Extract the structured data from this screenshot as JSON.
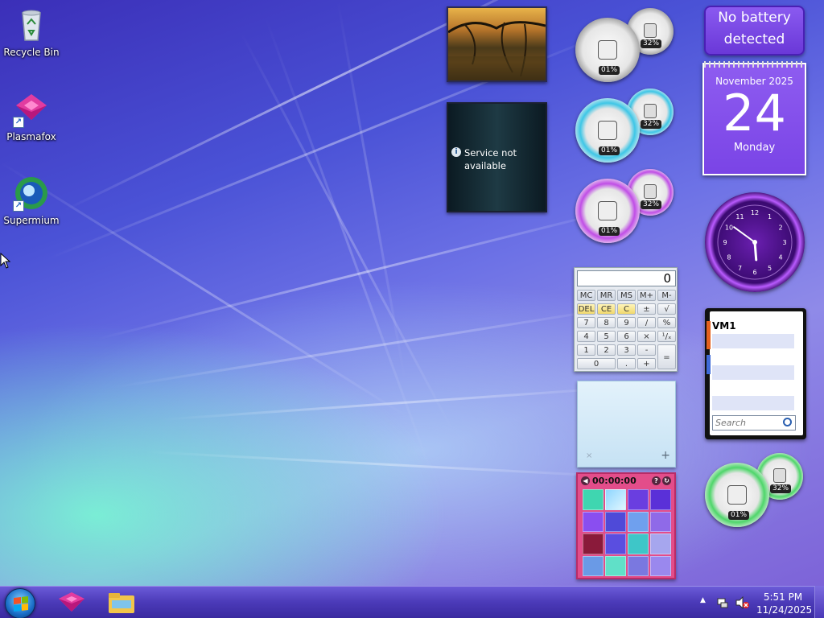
{
  "desktop": {
    "icons": [
      {
        "label": "Recycle Bin",
        "icon": "recycle-bin-icon"
      },
      {
        "label": "Plasmafox",
        "icon": "plasmafox-icon"
      },
      {
        "label": "Supermium",
        "icon": "supermium-icon"
      }
    ]
  },
  "gadgets": {
    "battery": {
      "line1": "No battery",
      "line2": "detected"
    },
    "calendar": {
      "month_year": "November 2025",
      "day": "24",
      "weekday": "Monday"
    },
    "clock": {
      "time": "5:51",
      "numerals": [
        "12",
        "1",
        "2",
        "3",
        "4",
        "5",
        "6",
        "7",
        "8",
        "9",
        "10",
        "11"
      ]
    },
    "feed": {
      "message": "Service not available"
    },
    "meters": [
      {
        "cpu": "01%",
        "memory": "32%",
        "accent": "#d8d8d8"
      },
      {
        "cpu": "01%",
        "memory": "32%",
        "accent": "#3ec6e6"
      },
      {
        "cpu": "01%",
        "memory": "32%",
        "accent": "#c04ee6"
      },
      {
        "cpu": "01%",
        "memory": "32%",
        "accent": "#4ed66a"
      }
    ],
    "calculator": {
      "display": "0",
      "keys": [
        [
          "MC",
          "MR",
          "MS",
          "M+",
          "M-"
        ],
        [
          "DEL",
          "CE",
          "C",
          "±",
          "√"
        ],
        [
          "7",
          "8",
          "9",
          "/",
          "%"
        ],
        [
          "4",
          "5",
          "6",
          "×",
          "¹/ₓ"
        ],
        [
          "1",
          "2",
          "3",
          "-",
          "="
        ],
        [
          "0",
          ".",
          "+"
        ]
      ]
    },
    "sticky_note": {
      "add": "+",
      "delete": "×"
    },
    "puzzle": {
      "timer": "00:00:00"
    },
    "contacts": {
      "title": "VM1",
      "search_placeholder": "Search"
    }
  },
  "taskbar": {
    "pinned": [
      {
        "name": "Plasmafox",
        "icon": "plasmafox-icon"
      },
      {
        "name": "File Explorer",
        "icon": "folder-icon"
      }
    ],
    "clock": {
      "time": "5:51 PM",
      "date": "11/24/2025"
    }
  }
}
